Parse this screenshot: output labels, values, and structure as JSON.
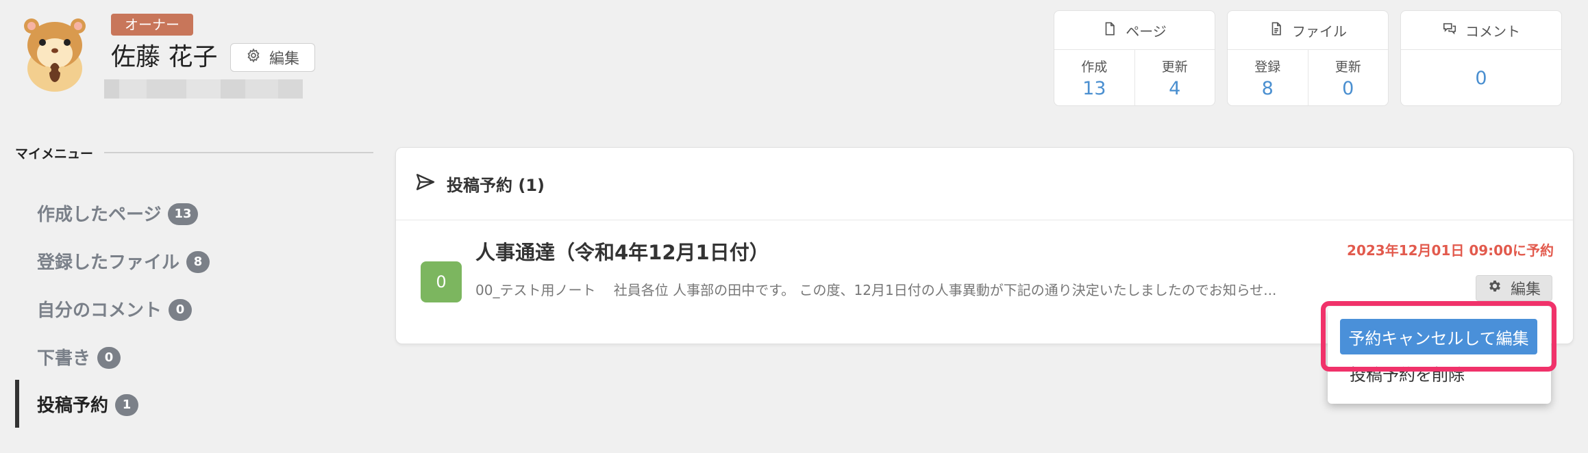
{
  "profile": {
    "role_badge": "オーナー",
    "name": "佐藤 花子",
    "edit_label": "編集"
  },
  "stats": [
    {
      "title": "ページ",
      "icon": "file-icon",
      "cols": [
        {
          "label": "作成",
          "value": "13"
        },
        {
          "label": "更新",
          "value": "4"
        }
      ]
    },
    {
      "title": "ファイル",
      "icon": "document-icon",
      "cols": [
        {
          "label": "登録",
          "value": "8"
        },
        {
          "label": "更新",
          "value": "0"
        }
      ]
    },
    {
      "title": "コメント",
      "icon": "comments-icon",
      "value": "0"
    }
  ],
  "menu": {
    "title": "マイメニュー",
    "items": [
      {
        "label": "作成したページ",
        "count": "13"
      },
      {
        "label": "登録したファイル",
        "count": "8"
      },
      {
        "label": "自分のコメント",
        "count": "0"
      },
      {
        "label": "下書き",
        "count": "0"
      },
      {
        "label": "投稿予約",
        "count": "1",
        "active": true
      }
    ]
  },
  "scheduled": {
    "heading": "投稿予約 (1)",
    "entry": {
      "badge": "0",
      "title": "人事通達（令和4年12月1日付）",
      "excerpt": "00_テスト用ノート　 社員各位 人事部の田中です。 この度、12月1日付の人事異動が下記の通り決定いたしましたのでお知らせ...",
      "schedule": "2023年12月01日 09:00に予約",
      "edit_label": "編集"
    },
    "dropdown": {
      "cancel_edit": "予約キャンセルして編集",
      "delete": "投稿予約を削除"
    }
  },
  "colors": {
    "accent": "#4a8fd0",
    "owner_badge": "#c8765a",
    "schedule_text": "#e25a4d",
    "entry_badge": "#7cb65f",
    "highlight": "#f0326a",
    "count_badge": "#7b8088"
  }
}
